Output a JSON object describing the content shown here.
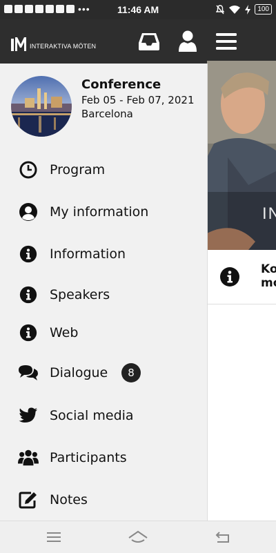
{
  "status_bar": {
    "time": "11:46 AM",
    "battery": "100",
    "icons_left": [
      "notification-icon",
      "notification-icon",
      "notification-icon",
      "youtube-icon",
      "notification-icon",
      "notification-icon",
      "notification-icon"
    ],
    "more": "•••",
    "icons_right": [
      "mute-icon",
      "wifi-icon",
      "charging-icon",
      "battery-icon"
    ]
  },
  "header": {
    "logo_text": "INTERAKTIVA MÖTEN",
    "icons": [
      "inbox-icon",
      "user-icon",
      "menu-icon"
    ]
  },
  "drawer": {
    "conference": {
      "title": "Conference",
      "dates": "Feb 05 - Feb 07, 2021",
      "city": "Barcelona"
    },
    "items": [
      {
        "label": "Program",
        "icon": "clock-icon"
      },
      {
        "label": "My information",
        "icon": "user-circle-icon"
      },
      {
        "label": "Information",
        "icon": "info-icon"
      },
      {
        "label": "Speakers",
        "icon": "info-icon"
      },
      {
        "label": "Web",
        "icon": "info-icon"
      },
      {
        "label": "Dialogue",
        "icon": "comments-icon",
        "badge": "8"
      },
      {
        "label": "Social media",
        "icon": "twitter-icon"
      },
      {
        "label": "Participants",
        "icon": "users-icon"
      },
      {
        "label": "Notes",
        "icon": "edit-icon"
      }
    ]
  },
  "content": {
    "photo_text": "IN",
    "row_text_line1": "Ko",
    "row_text_line2": "mo"
  },
  "bottom_nav": {
    "icons": [
      "recents-icon",
      "home-icon",
      "back-icon"
    ]
  },
  "colors": {
    "header_bg": "#2e2e2e",
    "drawer_bg": "#f1f1f1",
    "text": "#111111",
    "badge_bg": "#222222"
  }
}
